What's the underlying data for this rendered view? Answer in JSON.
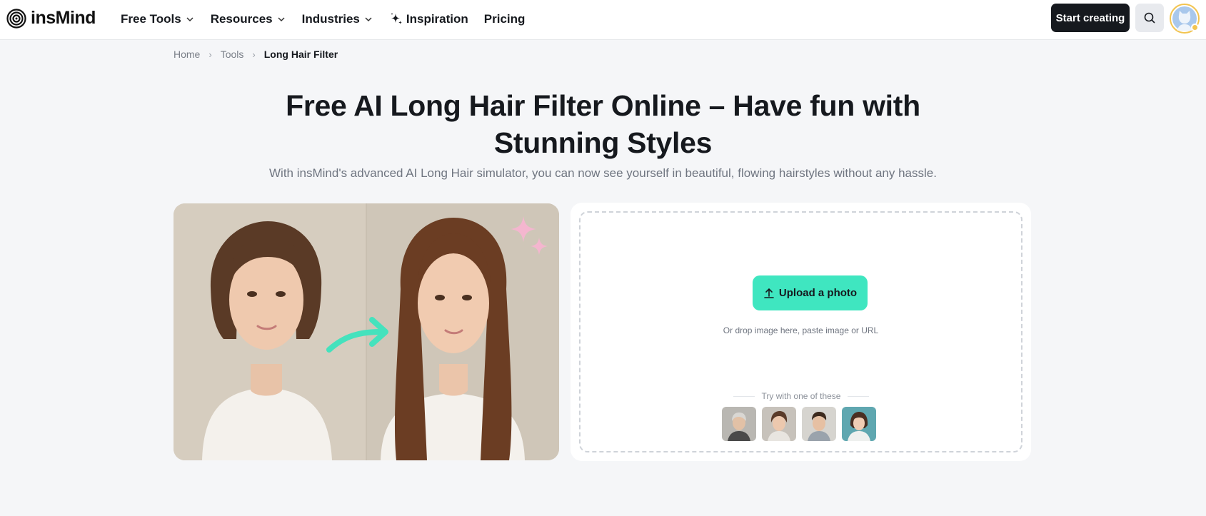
{
  "brand": {
    "name": "insMind"
  },
  "nav": {
    "items": [
      {
        "label": "Free Tools",
        "dropdown": true
      },
      {
        "label": "Resources",
        "dropdown": true
      },
      {
        "label": "Industries",
        "dropdown": true
      },
      {
        "label": "Inspiration",
        "icon": "sparkle-icon"
      },
      {
        "label": "Pricing"
      }
    ]
  },
  "header": {
    "start_label": "Start creating",
    "search_icon": "search-icon",
    "avatar_icon": "user-avatar"
  },
  "breadcrumb": {
    "items": [
      "Home",
      "Tools",
      "Long Hair Filter"
    ]
  },
  "hero": {
    "title": "Free AI Long Hair Filter Online – Have fun with Stunning Styles",
    "subtitle": "With insMind's advanced AI Long Hair simulator, you can now see yourself in beautiful, flowing hairstyles without any hassle."
  },
  "upload": {
    "button_label": "Upload a photo",
    "button_icon": "upload-icon",
    "hint": "Or drop image here, paste image or URL",
    "try_label": "Try with one of these",
    "samples": [
      "sample-elderly-woman",
      "sample-short-hair-woman",
      "sample-young-man",
      "sample-bob-hair-woman"
    ]
  },
  "colors": {
    "accent": "#3fe6c0",
    "dark": "#16191e",
    "page_bg": "#f5f6f8"
  }
}
